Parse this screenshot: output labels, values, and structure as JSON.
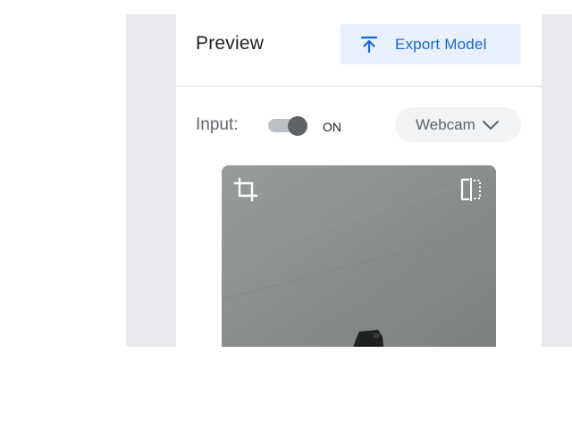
{
  "preview": {
    "title": "Preview",
    "export_button": {
      "label": "Export Model",
      "icon": "upload-arrow-icon"
    }
  },
  "input": {
    "label": "Input:",
    "toggle": {
      "state_label": "ON",
      "on": true
    },
    "source_select": {
      "selected": "Webcam",
      "icon": "chevron-down-icon"
    }
  },
  "webcam_view": {
    "crop_icon": "crop-icon",
    "flip_icon": "flip-horizontal-icon"
  },
  "colors": {
    "accent": "#1967d2",
    "accent_bg": "#e8f0fe",
    "backdrop": "#e8e9ed",
    "toggle_knob": "#5f6368"
  }
}
